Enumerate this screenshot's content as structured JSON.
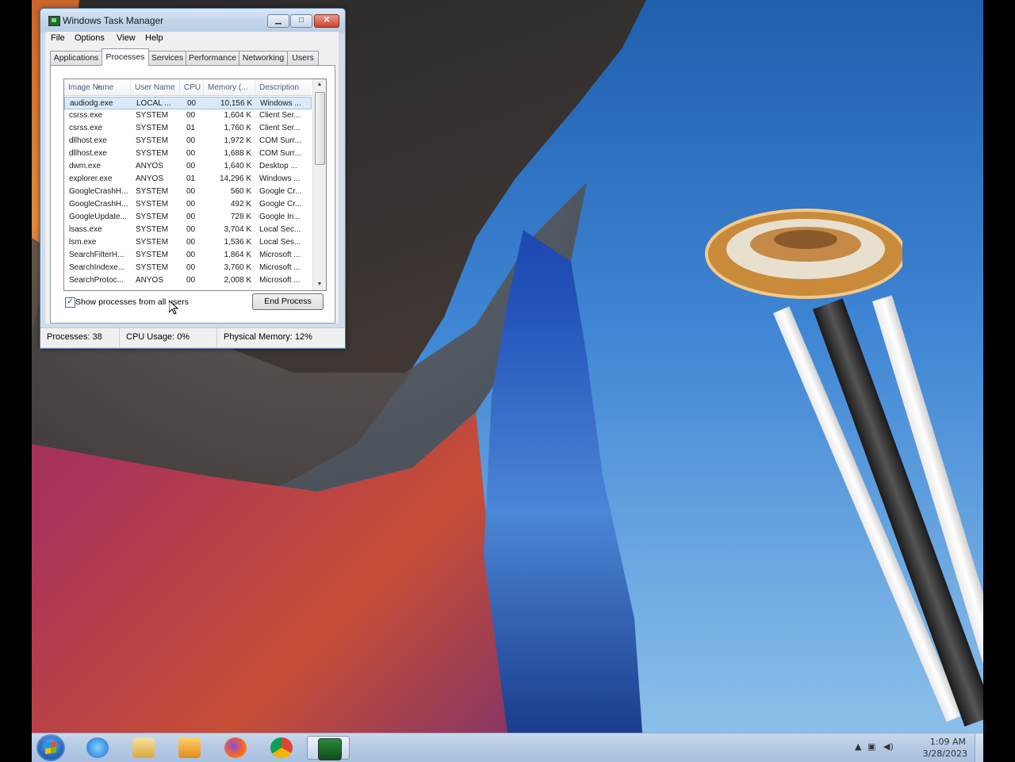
{
  "window": {
    "title": "Windows Task Manager",
    "minimize_glyph": "▁",
    "maximize_glyph": "□",
    "close_glyph": "✕"
  },
  "menu": [
    "File",
    "Options",
    "View",
    "Help"
  ],
  "tabs": [
    "Applications",
    "Processes",
    "Services",
    "Performance",
    "Networking",
    "Users"
  ],
  "active_tab": "Processes",
  "columns": [
    "Image Name",
    "User Name",
    "CPU",
    "Memory (...",
    "Description"
  ],
  "processes": [
    {
      "image": "audiodg.exe",
      "user": "LOCAL ...",
      "cpu": "00",
      "memory": "10,156 K",
      "description": "Windows ..."
    },
    {
      "image": "csrss.exe",
      "user": "SYSTEM",
      "cpu": "00",
      "memory": "1,604 K",
      "description": "Client Ser..."
    },
    {
      "image": "csrss.exe",
      "user": "SYSTEM",
      "cpu": "01",
      "memory": "1,760 K",
      "description": "Client Ser..."
    },
    {
      "image": "dllhost.exe",
      "user": "SYSTEM",
      "cpu": "00",
      "memory": "1,972 K",
      "description": "COM Surr..."
    },
    {
      "image": "dllhost.exe",
      "user": "SYSTEM",
      "cpu": "00",
      "memory": "1,688 K",
      "description": "COM Surr..."
    },
    {
      "image": "dwm.exe",
      "user": "ANYOS",
      "cpu": "00",
      "memory": "1,640 K",
      "description": "Desktop ..."
    },
    {
      "image": "explorer.exe",
      "user": "ANYOS",
      "cpu": "01",
      "memory": "14,296 K",
      "description": "Windows ..."
    },
    {
      "image": "GoogleCrashH...",
      "user": "SYSTEM",
      "cpu": "00",
      "memory": "560 K",
      "description": "Google Cr..."
    },
    {
      "image": "GoogleCrashH...",
      "user": "SYSTEM",
      "cpu": "00",
      "memory": "492 K",
      "description": "Google Cr..."
    },
    {
      "image": "GoogleUpdate...",
      "user": "SYSTEM",
      "cpu": "00",
      "memory": "728 K",
      "description": "Google In..."
    },
    {
      "image": "lsass.exe",
      "user": "SYSTEM",
      "cpu": "00",
      "memory": "3,704 K",
      "description": "Local Sec..."
    },
    {
      "image": "lsm.exe",
      "user": "SYSTEM",
      "cpu": "00",
      "memory": "1,536 K",
      "description": "Local Ses..."
    },
    {
      "image": "SearchFilterH...",
      "user": "SYSTEM",
      "cpu": "00",
      "memory": "1,864 K",
      "description": "Microsoft ..."
    },
    {
      "image": "SearchIndexe...",
      "user": "SYSTEM",
      "cpu": "00",
      "memory": "3,760 K",
      "description": "Microsoft ..."
    },
    {
      "image": "SearchProtoc...",
      "user": "ANYOS",
      "cpu": "00",
      "memory": "2,008 K",
      "description": "Microsoft ..."
    }
  ],
  "selected_process_index": 0,
  "show_all_users": {
    "label": "Show processes from all users",
    "checked": true,
    "check_glyph": "✓"
  },
  "end_process_label": "End Process",
  "status": {
    "processes": "Processes: 38",
    "cpu_usage": "CPU Usage: 0%",
    "physical_memory": "Physical Memory: 12%"
  },
  "taskbar": {
    "pinned": [
      "start-orb",
      "internet-explorer-icon",
      "windows-explorer-icon",
      "media-player-icon",
      "firefox-icon",
      "chrome-icon",
      "task-manager-icon"
    ],
    "active_app": "task-manager-icon",
    "tray_chevron": "▲",
    "clock_time": "1:09 AM",
    "clock_date": "3/28/2023"
  },
  "colors": {
    "title_bar": "#c4d5ea",
    "selection": "#dbe9f8",
    "taskbar": "#b4c9e3",
    "close_button": "#c9452f"
  }
}
